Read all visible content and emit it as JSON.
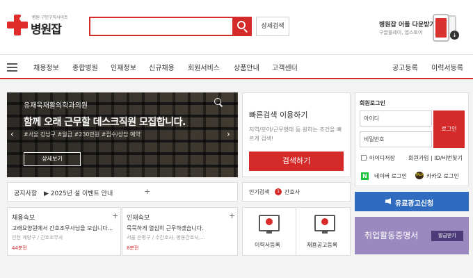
{
  "header": {
    "logo_tag": "병원 구인구직사이트",
    "logo_name": "병원잡",
    "search_placeholder": "",
    "advanced_search": "상세검색",
    "app_title": "병원잡 어플 다운받기",
    "app_subtitle": "구글플레이, 앱스토어"
  },
  "nav": {
    "left": [
      "채용정보",
      "종합병원",
      "인재정보",
      "신규채용",
      "회원서비스",
      "상품안내",
      "고객센터"
    ],
    "right": [
      "공고등록",
      "이력서등록"
    ]
  },
  "banner": {
    "subtitle": "유재욱재활의학과의원",
    "title": "함께 오래 근무할 데스크직원 모집합니다.",
    "tags": "#서울 강남구 #월급 #230만원 #접수/상담 예약",
    "button": "상세보기",
    "prev": "‹",
    "next": "›"
  },
  "quick_search": {
    "title": "빠른검색 이용하기",
    "description": "지역/분야/근무형태 등 원하는 조건을 빠르게 검색!",
    "button": "검색하기"
  },
  "notice": {
    "label": "공지사항",
    "text": "▶ 2025년 설 이벤트 안내",
    "plus": "+"
  },
  "popular": {
    "label": "인기검색",
    "rank": "1",
    "keyword": "간호사"
  },
  "cards": [
    {
      "title": "채용속보",
      "plus": "+",
      "line": "고래요양원에서 간호조무사님을 모십니다...",
      "meta": "인천 계양구 / 간호조무사",
      "time": "44분전"
    },
    {
      "title": "인재속보",
      "plus": "+",
      "line": "묵묵하게 열심히 근무하겠습니다.",
      "meta": "서울 은평구 / 수간호사, 병동간호사,...",
      "time": "8분전"
    }
  ],
  "quick_links": [
    "이력서등록",
    "채용공고등록"
  ],
  "login": {
    "title": "회원로그인",
    "id_placeholder": "아이디",
    "pw_placeholder": "비밀번호",
    "button": "로그인",
    "save_id": "아이디저장",
    "join": "회원가입 | ID/비번찾기",
    "naver": "네이버 로그인",
    "naver_icon": "N",
    "kakao": "카카오 로그인",
    "kakao_icon": "TALK"
  },
  "ad_button": "유료광고신청",
  "certificate": {
    "label": "취업활동증명서",
    "button": "발급받기"
  },
  "colors": {
    "brand_red": "#d42a2a",
    "ad_blue": "#2f6bbf",
    "cert_purple": "#9a89bf"
  }
}
